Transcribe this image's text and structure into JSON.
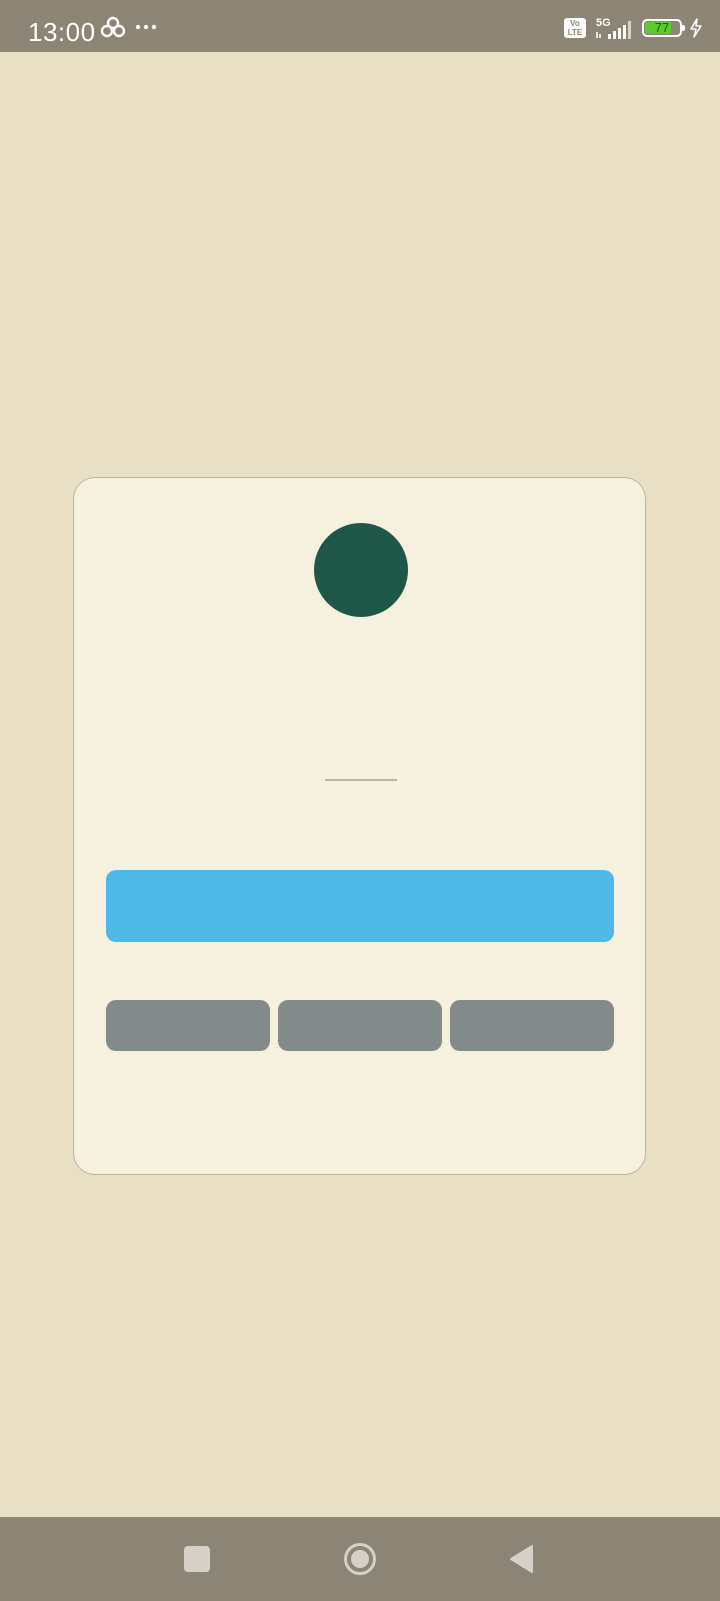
{
  "status_bar": {
    "time": "13:00",
    "signal_label": "5G",
    "volte_label": "Vo LTE",
    "battery_level": "77",
    "battery_fraction": 0.77,
    "battery_color": "#5BCB2E"
  },
  "card": {
    "avatar_color": "#1E5748",
    "primary_button_label": "",
    "secondary_buttons": [
      "",
      "",
      ""
    ]
  },
  "colors": {
    "background": "#E8DFC4",
    "card_background": "#F6F0DE",
    "card_border": "#BDB49B",
    "primary_button": "#4EB8E6",
    "secondary_button": "#838A8A",
    "system_bars": "#8C8575"
  },
  "nav_bar": {
    "icons": [
      "recent-apps-icon",
      "home-icon",
      "back-icon"
    ]
  }
}
